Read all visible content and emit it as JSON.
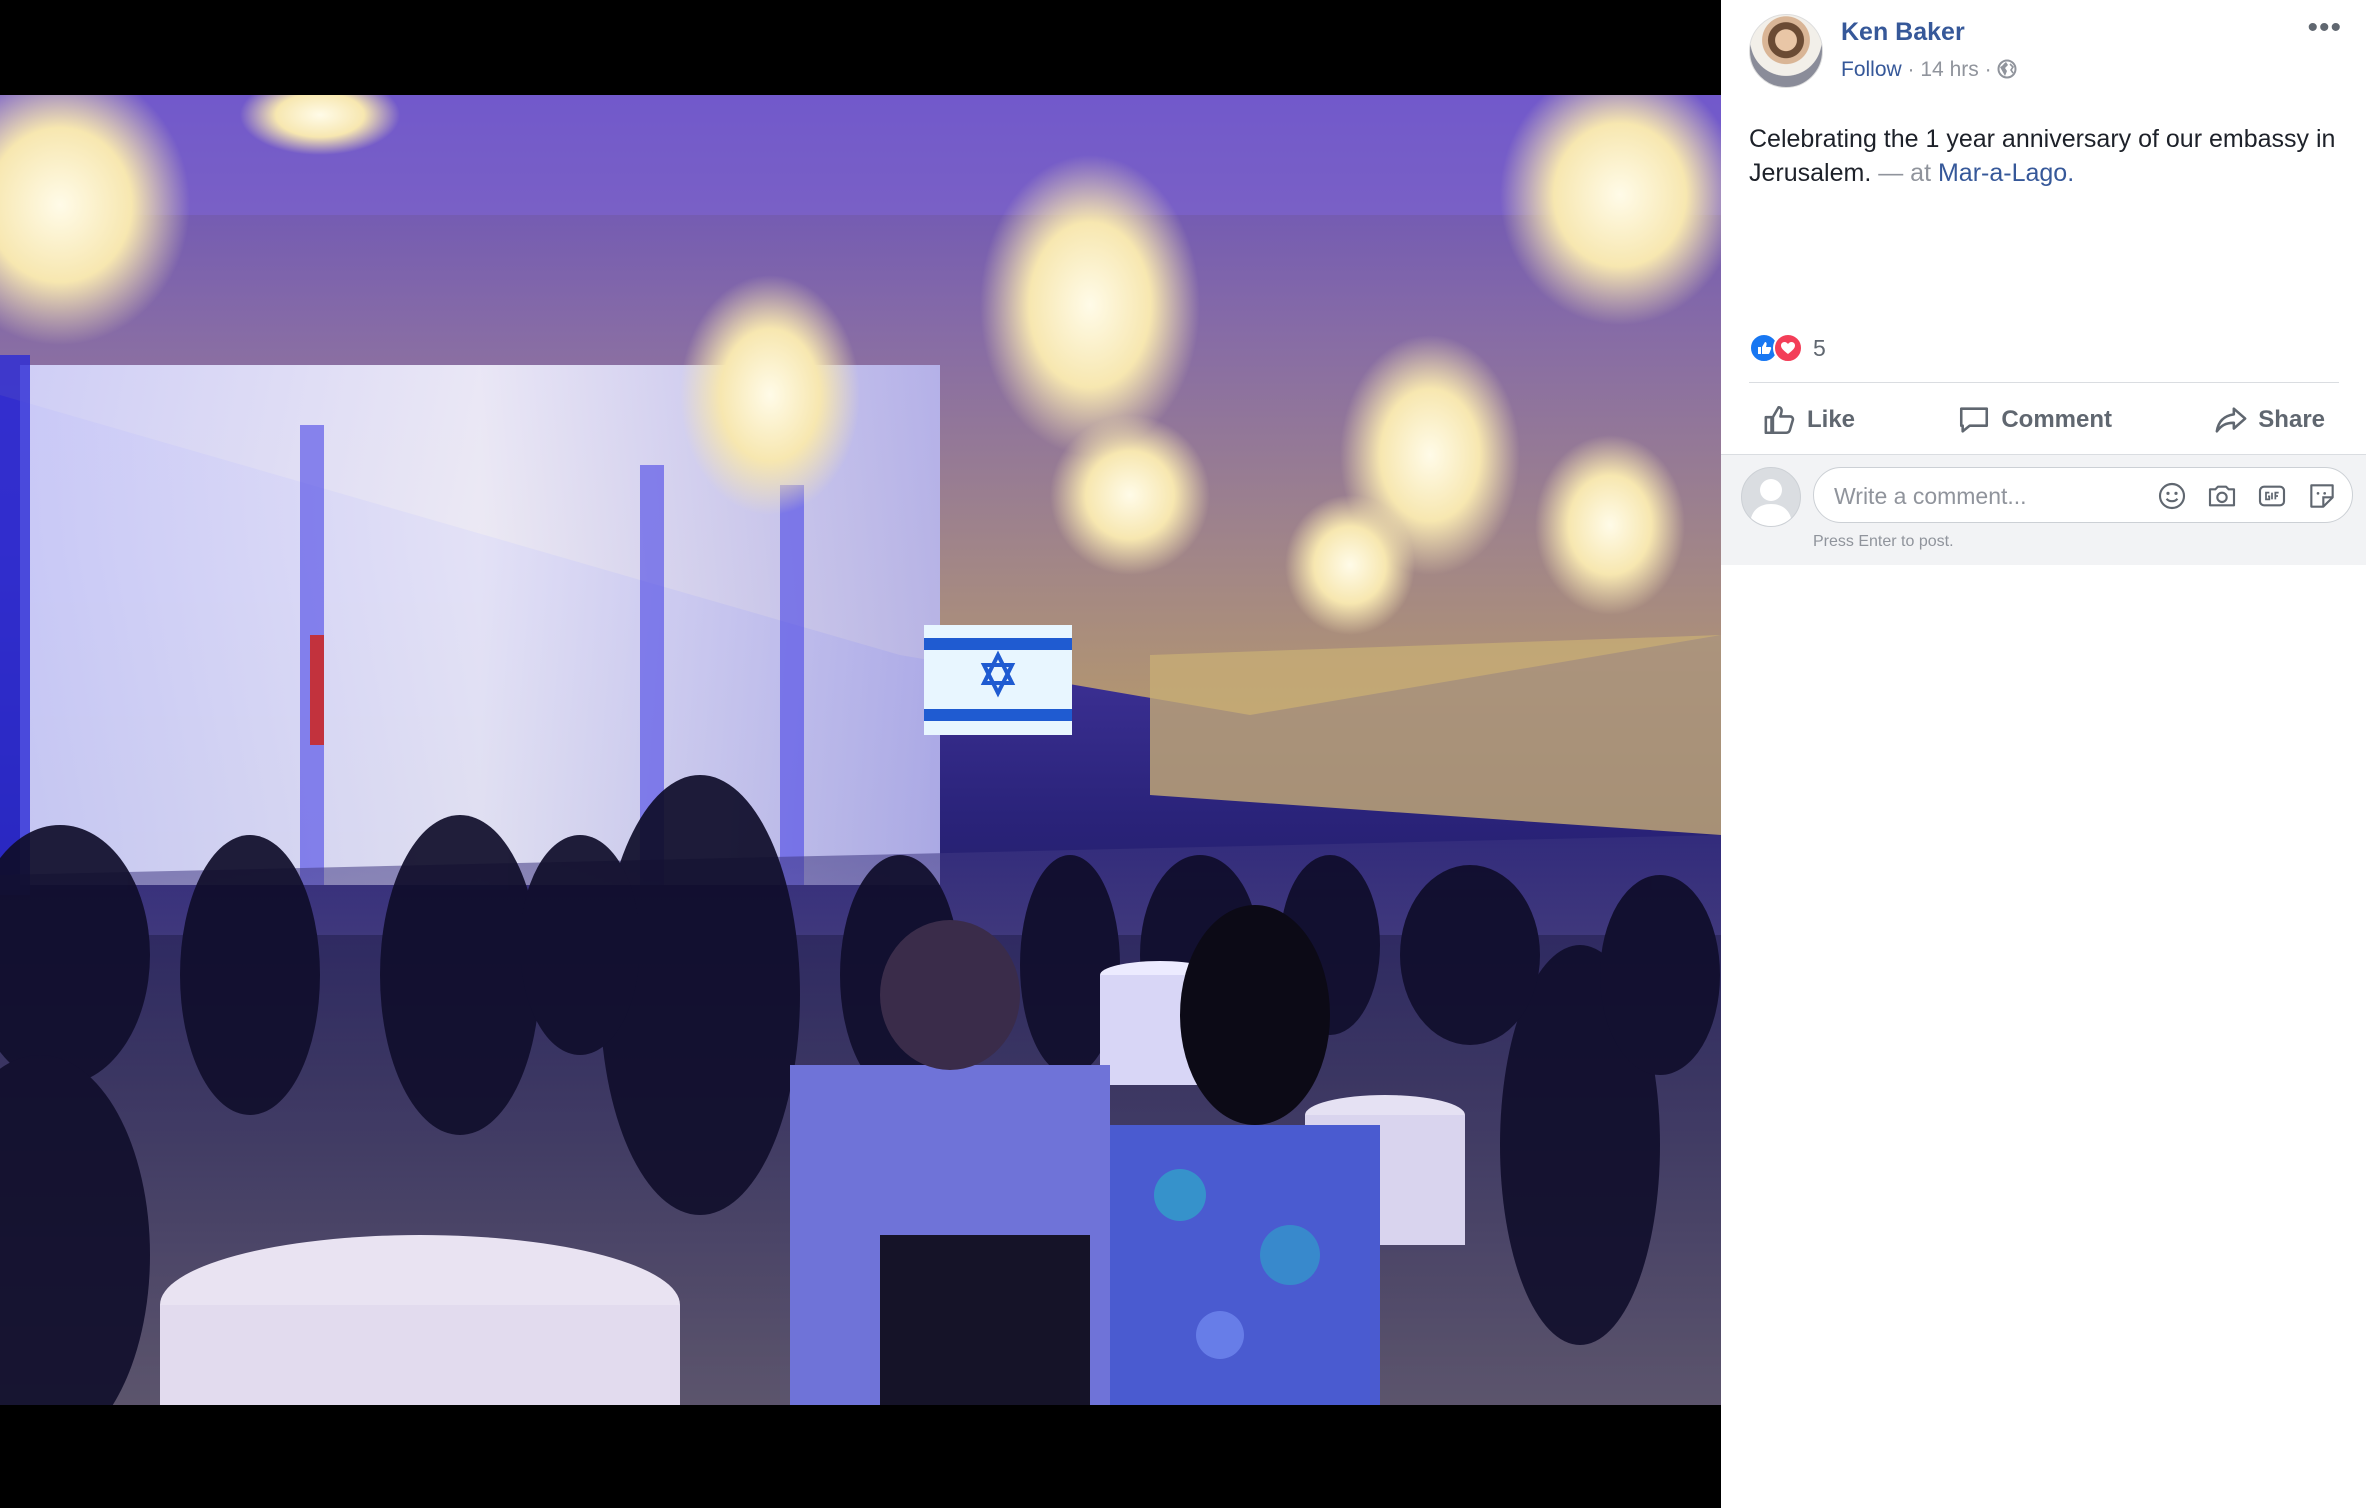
{
  "post": {
    "author": "Ken Baker",
    "follow_label": "Follow",
    "separator": "·",
    "time": "14 hrs",
    "privacy_icon": "globe-icon",
    "caption_text": "Celebrating the 1 year anniversary of our embassy in Jerusalem.",
    "caption_at": "— at",
    "caption_place": "Mar-a-Lago.",
    "reaction_count": "5",
    "more_icon": "more-options-icon"
  },
  "actions": {
    "like": "Like",
    "comment": "Comment",
    "share": "Share"
  },
  "comment": {
    "placeholder": "Write a comment...",
    "hint": "Press Enter to post."
  },
  "colors": {
    "link": "#365899",
    "like_blue": "#1877f2",
    "love_red": "#f33e58",
    "muted": "#90949c"
  }
}
